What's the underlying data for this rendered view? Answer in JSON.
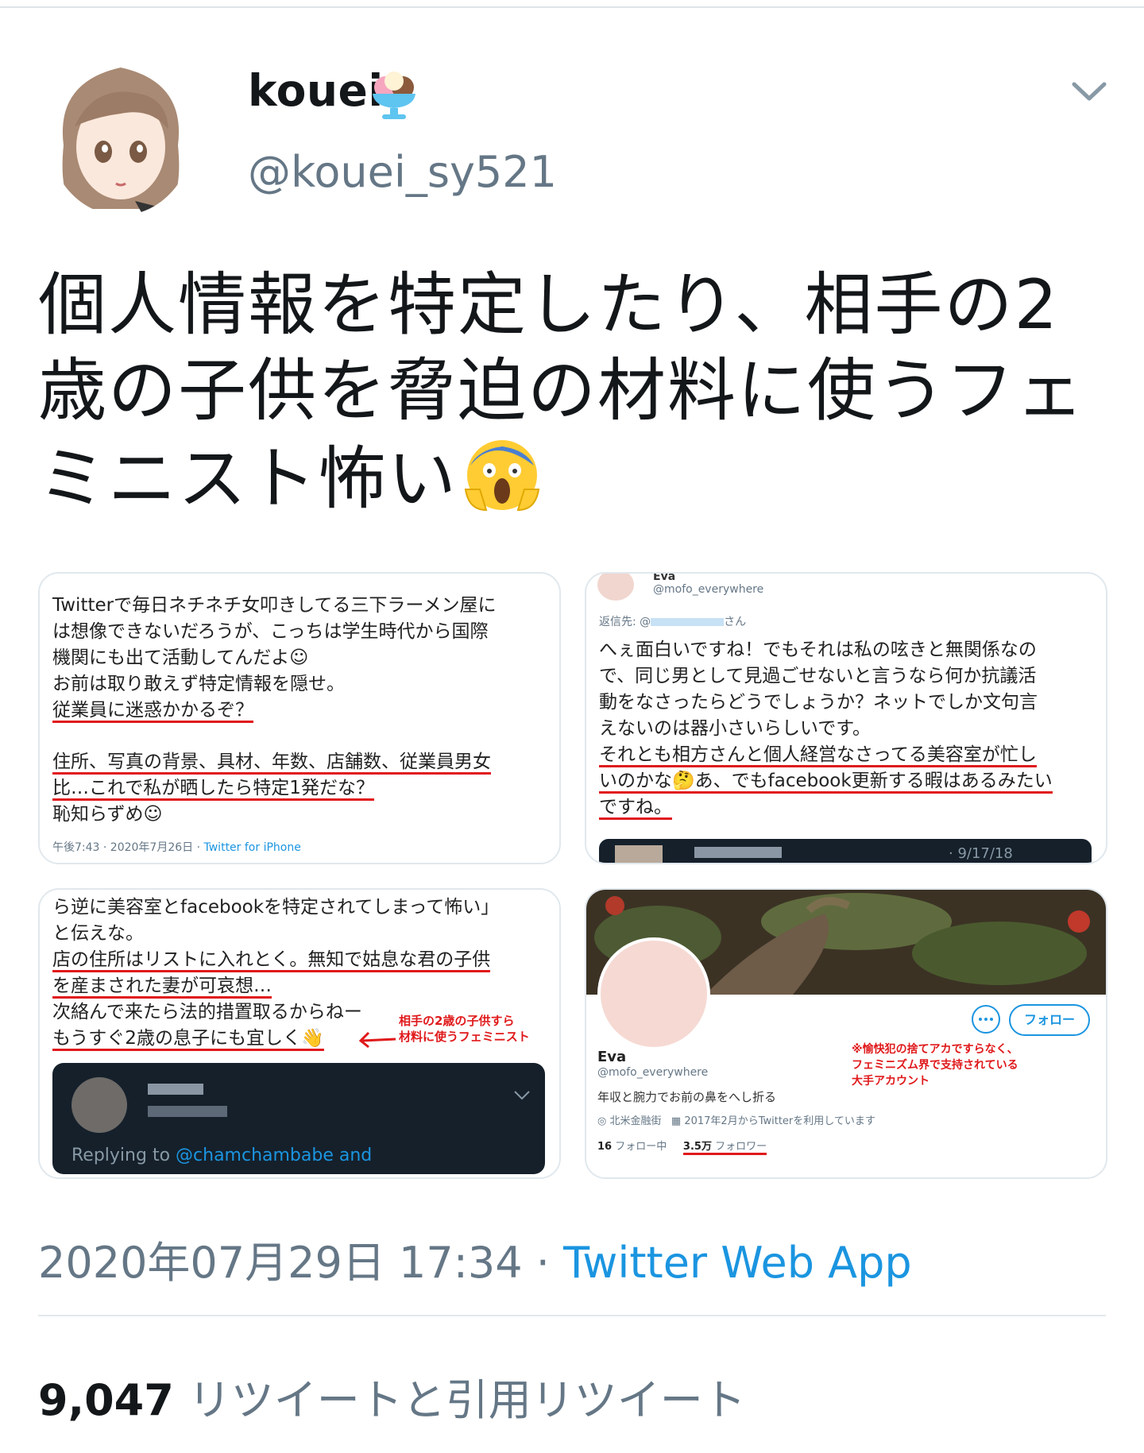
{
  "header": {
    "display_name": "kouei",
    "handle": "@kouei_sy521"
  },
  "tweet": {
    "line1": "個人情報を特定したり、相手の2",
    "line2": "歳の子供を脅迫の材料に使うフェ",
    "line3": "ミニスト怖い"
  },
  "media": {
    "card1": {
      "lines": [
        "Twitterで毎日ネチネチ女叩きしてる三下ラーメン屋に",
        "は想像できないだろうが、こっちは学生時代から国際",
        "機関にも出て活動してんだよ☺",
        "お前は取り敢えず特定情報を隠せ。",
        "従業員に迷惑かかるぞ？",
        "住所、写真の背景、具材、年数、店舗数、従業員男女",
        "比…これで私が晒したら特定1発だな？",
        "恥知らずめ☺"
      ],
      "meta_time": "午後7:43 · 2020年7月26日 · ",
      "meta_source": "Twitter for iPhone"
    },
    "card2": {
      "name": "Eva",
      "handle": "@mofo_everywhere",
      "reply_prefix": "返信先: @",
      "reply_suffix": "さん",
      "lines": [
        "へぇ面白いですね！でもそれは私の呟きと無関係なの",
        "で、同じ男として見過ごせないと言うなら何か抗議活",
        "動をなさったらどうでしょうか？ネットでしか文句言",
        "えないのは器小さいらしいです。",
        "それとも相方さんと個人経営なさってる美容室が忙し",
        "いのかな🤔あ、でもfacebook更新する暇はあるみたい",
        "ですね。"
      ],
      "quote_date": "· 9/17/18"
    },
    "card3": {
      "lines": [
        "ら逆に美容室とfacebookを特定されてしまって怖い」",
        "と伝えな。",
        "店の住所はリストに入れとく。無知で姑息な君の子供",
        "を産まされた妻が可哀想…",
        "次絡んで来たら法的措置取るからねー",
        "もうすぐ2歳の息子にも宜しく👋"
      ],
      "annotation1": "相手の2歳の子供すら",
      "annotation2": "材料に使うフェミニスト",
      "reply_prefix": "Replying to ",
      "reply_handle": "@chamchambabe and"
    },
    "card4": {
      "follow_button": "フォロー",
      "name": "Eva",
      "handle": "@mofo_everywhere",
      "bio": "年収と腕力でお前の鼻をへし折る",
      "location": "北米金融街",
      "joined": "2017年2月からTwitterを利用しています",
      "following_count": "16",
      "following_label": "フォロー中",
      "followers_count": "3.5万",
      "followers_label": "フォロワー",
      "note1": "※愉快犯の捨てアカですらなく、",
      "note2": "フェミニズム界で支持されている",
      "note3": "大手アカウント"
    }
  },
  "footer": {
    "timestamp": "2020年07月29日 17:34 · ",
    "source": "Twitter Web App",
    "retweet_count": "9,047",
    "retweet_label": "リツイートと引用リツイート"
  }
}
